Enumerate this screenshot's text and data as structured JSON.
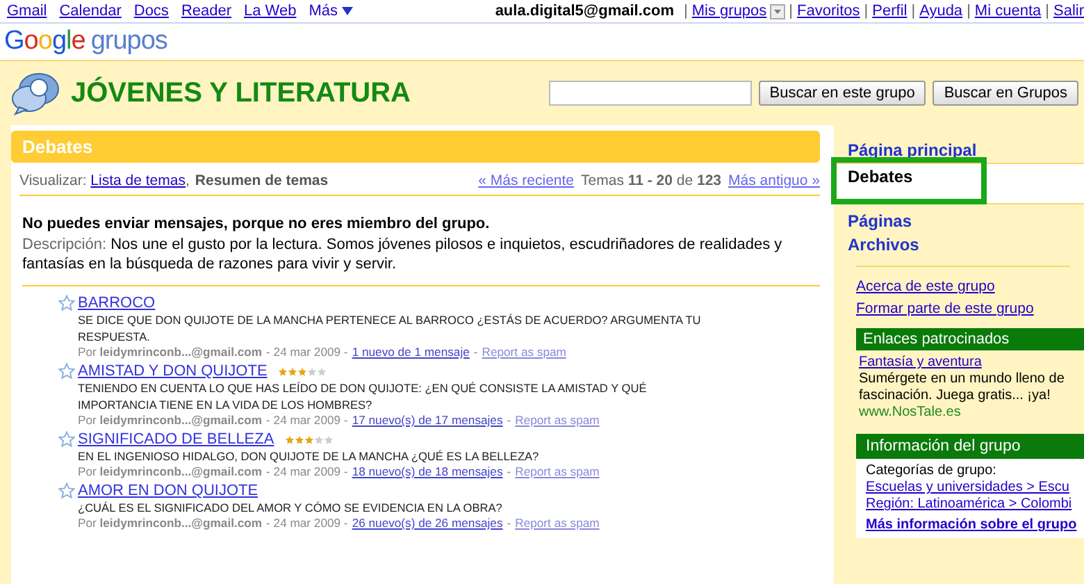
{
  "top_bar": {
    "links": [
      "Gmail",
      "Calendar",
      "Docs",
      "Reader",
      "La Web"
    ],
    "more": "Más",
    "account": "aula.digital5@gmail.com",
    "account_links": [
      "Mis grupos",
      "Favoritos",
      "Perfil",
      "Ayuda",
      "Mi cuenta",
      "Salir"
    ],
    "separator": "|"
  },
  "logo": {
    "brand": "Google",
    "product": "grupos"
  },
  "group": {
    "title": "JÓVENES Y LITERATURA",
    "search_buttons": [
      "Buscar en este grupo",
      "Buscar en Grupos"
    ]
  },
  "section": {
    "title": "Debates",
    "view_label": "Visualizar:",
    "view_separator": ",",
    "view_links": [
      {
        "label": "Lista de temas",
        "selected": false
      },
      {
        "label": "Resumen de temas",
        "selected": true
      }
    ],
    "newer": "« Más reciente",
    "range": "Temas **11 - 20** de **123**",
    "older": "Más antiguo »",
    "notice": "No puedes enviar mensajes, porque no eres miembro del grupo.",
    "description_label": "Descripción:",
    "description": "Nos une el gusto por la lectura.  Somos jóvenes pilosos e inquietos, escudriñadores de realidades y fantasías en la búsqueda de razones para vivir y servir."
  },
  "topics": [
    {
      "title": "BARROCO",
      "summary": "SE DICE QUE DON QUIJOTE DE LA MANCHA PERTENECE AL BARROCO ¿ESTÁS DE ACUERDO? ARGUMENTA TU RESPUESTA.",
      "by": "Por **leidymrinconb...@gmail.com**",
      "date": "- 24 mar 2009 -",
      "messages": "1 nuevo de 1 mensaje",
      "separator": "-",
      "spam": "Report as spam"
    },
    {
      "title": "AMISTAD Y DON QUIJOTE",
      "stars": 3,
      "summary": "TENIENDO EN CUENTA LO QUE HAS LEÍDO DE DON QUIJOTE: ¿EN QUÉ CONSISTE LA AMISTAD Y QUÉ IMPORTANCIA TIENE EN LA VIDA DE LOS HOMBRES?",
      "by": "Por **leidymrinconb...@gmail.com**",
      "date": "- 24 mar 2009 -",
      "messages": "17 nuevo(s) de 17 mensajes",
      "separator": "-",
      "spam": "Report as spam"
    },
    {
      "title": "SIGNIFICADO DE BELLEZA",
      "stars": 3,
      "summary": "EN EL INGENIOSO HIDALGO, DON QUIJOTE DE LA MANCHA ¿QUÉ ES LA BELLEZA?",
      "by": "Por **leidymrinconb...@gmail.com**",
      "date": "- 24 mar 2009 -",
      "messages": "18 nuevo(s) de 18 mensajes",
      "separator": "-",
      "spam": "Report as spam"
    },
    {
      "title": "AMOR EN DON QUIJOTE",
      "summary": "¿CUÁL ES EL SIGNIFICADO DEL AMOR Y CÓMO SE EVIDENCIA EN LA OBRA?",
      "by": "Por **leidymrinconb...@gmail.com**",
      "date": "- 24 mar 2009 -",
      "messages": "26 nuevo(s) de 26 mensajes",
      "separator": "-",
      "spam": "Report as spam"
    }
  ],
  "sidebar": {
    "nav": [
      {
        "label": "Página principal",
        "selected": false
      },
      {
        "label": "Debates",
        "selected": true
      },
      {
        "label": "Páginas",
        "selected": false
      },
      {
        "label": "Archivos",
        "selected": false
      }
    ],
    "links": [
      "Acerca de este grupo",
      "Formar parte de este grupo"
    ],
    "sponsored": {
      "title": "Enlaces patrocinados",
      "ad_title": "Fantasía y aventura",
      "ad_text": "Sumérgete en un mundo lleno de fascinación. Juega gratis... ¡ya!",
      "ad_url": "www.NosTale.es"
    },
    "info": {
      "title": "Información del grupo",
      "label": "Categorías de grupo:",
      "categories": [
        "Escuelas y universidades > Escu",
        "Región: Latinoamérica > Colombi"
      ],
      "more": "Más información sobre el grupo"
    }
  }
}
